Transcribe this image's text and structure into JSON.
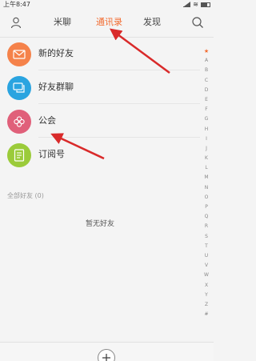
{
  "status_bar": {
    "time": "上午8:47"
  },
  "tabs": [
    {
      "label": "米聊",
      "active": false
    },
    {
      "label": "通讯录",
      "active": true
    },
    {
      "label": "发现",
      "active": false
    }
  ],
  "contacts_menu": [
    {
      "label": "新的好友",
      "icon": "envelope-icon",
      "color": "#f5824a"
    },
    {
      "label": "好友群聊",
      "icon": "chat-bubbles-icon",
      "color": "#2aa4e0"
    },
    {
      "label": "公会",
      "icon": "flower-icon",
      "color": "#e0607a"
    },
    {
      "label": "订阅号",
      "icon": "document-icon",
      "color": "#9bcb3a"
    }
  ],
  "friends_section": {
    "header": "全部好友 (0)",
    "empty_text": "暂无好友"
  },
  "index_letters": [
    "★",
    "A",
    "B",
    "C",
    "D",
    "E",
    "F",
    "G",
    "H",
    "I",
    "J",
    "K",
    "L",
    "M",
    "N",
    "O",
    "P",
    "Q",
    "R",
    "S",
    "T",
    "U",
    "V",
    "W",
    "X",
    "Y",
    "Z",
    "#"
  ],
  "colors": {
    "accent": "#f26a2e",
    "annotation_arrow": "#d92a2a"
  }
}
